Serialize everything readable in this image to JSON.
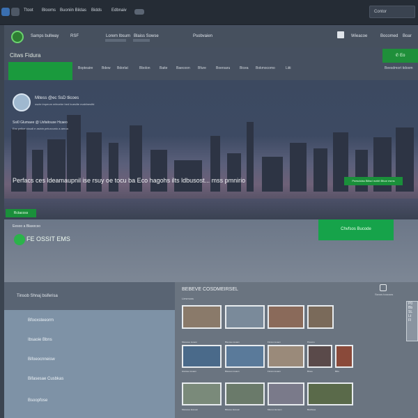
{
  "topbar": {
    "tabs": [
      "Ttoot",
      "Blooms",
      "Buoniin Bildas",
      "Bidds",
      "Edbnaiv"
    ],
    "search_value": "Contor"
  },
  "nav": {
    "brand": "Samps bullway",
    "brand_suffix": "RSF",
    "menu": [
      "Lorem Ibsum",
      "Blaiss Sowse",
      "Psobvaien"
    ],
    "right_items": [
      "Wieacoe",
      "Bocomed",
      "Boar"
    ]
  },
  "header": {
    "title": "Citws Fidura",
    "cta": "Eo",
    "sub_right": "Beesdmort tidoom"
  },
  "subnav": {
    "items": [
      "Bopteaire",
      "Bdew",
      "Bdorlat",
      "Bbolon",
      "Baite",
      "Baecoon",
      "Bfure",
      "Boersaru",
      "Bicea",
      "Bokmocomo",
      "Liiti"
    ]
  },
  "hero": {
    "line1": "Mitess @ec SsD tlicoes",
    "line2": "oscte impeum mfecebe bed buesiite mabiineslfd",
    "line3": "Ssi0 Glumaee @ Usfaitouse Hcaeo",
    "line4": "Enc pelice cloudi e asinin peluxcunio a aeroa",
    "headline": "Perfacs ces ldeamaupnil ise rsuy oe tocu ba Eco hagohs ilts ldbusost... mss pmnirio",
    "button": "Pnesdoiss Bitisd mzbit Bfuor esms"
  },
  "band": {
    "pill": "Rctacoss",
    "small": "Eesoo a Blasocso",
    "big": "FE OSSIT EMS",
    "button": "Chvfsos Bucode"
  },
  "sidebar": {
    "title": "Tinsob Shnaj bsiferisa",
    "items": [
      "Bfooxsteeorm",
      "Ibsaoie Bbns",
      "Bifoeocnneisw",
      "Bifasesae Cusbkas",
      "Bsoopfose"
    ]
  },
  "gallery": {
    "title": "BEBEVE COSDMEIRSEL",
    "subtitle": "Liesmuss",
    "icon_label": "Ssnos toocoos",
    "popup": [
      "P0",
      "Bb",
      "SL",
      "Lt",
      "Fl"
    ],
    "captions": [
      "Msssoue tooaon",
      "Bisooue tooaon",
      "Fisnus tooaon",
      "Pssomo",
      "Hssioue tooaon",
      "Bissooo tooaon",
      "Fisnos tooaon",
      "Btooe",
      "Biitu",
      "Msssoue Eonaon",
      "Bitsoue Eonaon",
      "Misnos Eonaon",
      "Bsshtsoe"
    ]
  },
  "colors": {
    "accent_green": "#1a9a3d",
    "hero_purple": "#6e6178",
    "sidebar_blue": "#7e92a6"
  }
}
